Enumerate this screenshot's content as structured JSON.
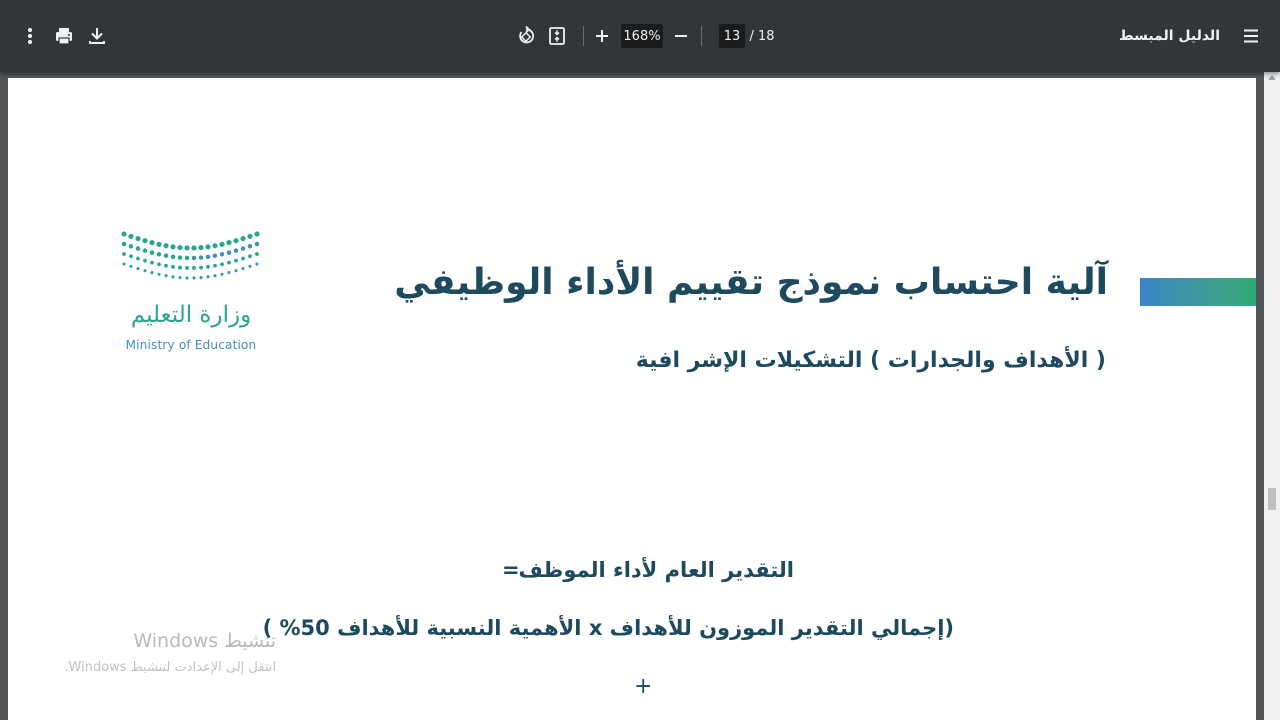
{
  "toolbar": {
    "title": "الدليل المبسط",
    "current_page": "13",
    "page_separator": "/ 18",
    "zoom": "168%",
    "icons": {
      "menu": "hamburger-menu-icon",
      "more": "more-vertical-icon",
      "print": "print-icon",
      "download": "download-icon",
      "rotate": "rotate-icon",
      "fit": "fit-to-page-icon",
      "zoom_in": "zoom-in-plus-icon",
      "zoom_out": "zoom-out-minus-icon"
    }
  },
  "page": {
    "logo": {
      "arabic": "وزارة التعليم",
      "english": "Ministry of Education",
      "colors": {
        "green": "#2aa58e",
        "blue": "#3f8fbf"
      }
    },
    "main_title": "آلية احتساب نموذج تقييم الأداء الوظيفي",
    "subtitle": "( الأهداف والجدارات ) التشكيلات الإشر افية",
    "formula": {
      "line1": "التقدير العام لأداء الموظف",
      "equals": "=",
      "line2": "(إجمالي التقدير الموزون للأهداف x الأهمية النسبية للأهداف 50% )",
      "plus": "+"
    },
    "text_color": "#1d4a5e",
    "accent_gradient": [
      "#3a86c6",
      "#2eaa74"
    ]
  },
  "watermark": {
    "title": "تنشيط Windows",
    "subtitle": "انتقل إلى الإعدادت لتنشيط Windows."
  }
}
